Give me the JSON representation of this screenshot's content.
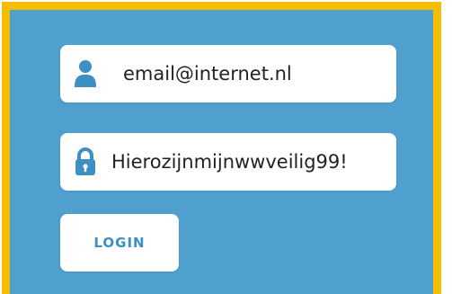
{
  "login_form": {
    "email_value": "email@internet.nl",
    "password_value": "Hierozijnmijnwwveilig99!",
    "login_label": "LOGIN"
  },
  "icons": {
    "email_field": "user-icon",
    "password_field": "lock-icon"
  },
  "colors": {
    "background": "#4f9fcf",
    "frame_border": "#f5bd00",
    "icon": "#3d8fc4",
    "button_text": "#3d8fc4"
  }
}
